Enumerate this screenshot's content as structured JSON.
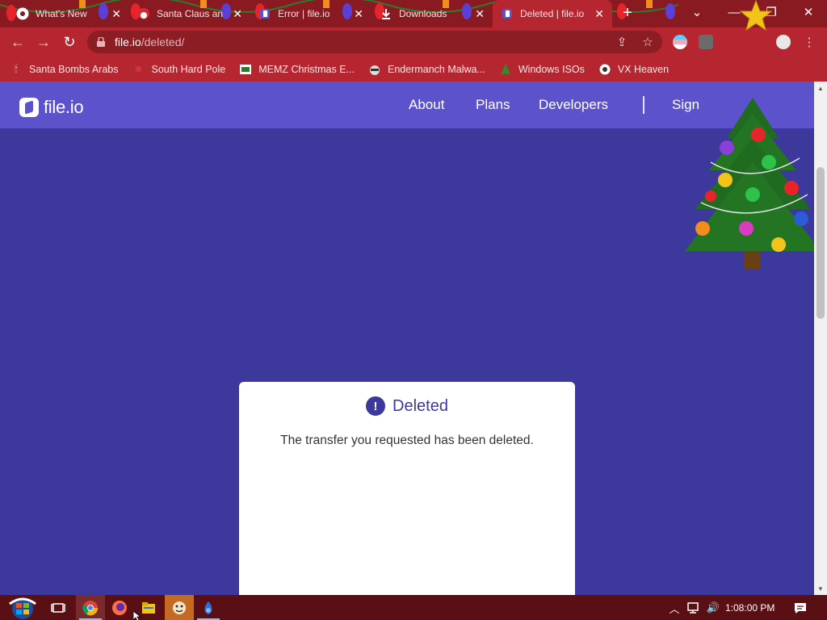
{
  "browser": {
    "tabs": [
      {
        "title": "What's New",
        "favicon": "chrome-icon",
        "active": false
      },
      {
        "title": "Santa Claus an",
        "favicon": "santa-icon",
        "active": false
      },
      {
        "title": "Error | file.io",
        "favicon": "fileio-icon",
        "active": false
      },
      {
        "title": "Downloads",
        "favicon": "download-icon",
        "active": false
      },
      {
        "title": "Deleted | file.io",
        "favicon": "fileio-icon",
        "active": true
      }
    ],
    "new_tab_label": "+",
    "address": {
      "host": "file.io",
      "path": "/deleted/"
    },
    "bookmarks": [
      {
        "label": "Santa Bombs Arabs",
        "icon": "candle-icon"
      },
      {
        "label": "South Hard Pole",
        "icon": "snowflake-icon"
      },
      {
        "label": "MEMZ Christmas E...",
        "icon": "memz-icon"
      },
      {
        "label": "Endermanch Malwa...",
        "icon": "raccoon-icon"
      },
      {
        "label": "Windows ISOs",
        "icon": "tree-icon"
      },
      {
        "label": "VX Heaven",
        "icon": "heaven-icon"
      }
    ]
  },
  "site": {
    "logo_text": "file.io",
    "nav": {
      "about": "About",
      "plans": "Plans",
      "developers": "Developers",
      "sign": "Sign"
    }
  },
  "card": {
    "icon_glyph": "!",
    "title": "Deleted",
    "message": "The transfer you requested has been deleted."
  },
  "taskbar": {
    "clock": "1:08:00 PM"
  },
  "colors": {
    "page_bg": "#3d389b",
    "header_bg": "#5c52cc",
    "browser_frame": "#b52630",
    "taskbar": "#5a0f14"
  }
}
